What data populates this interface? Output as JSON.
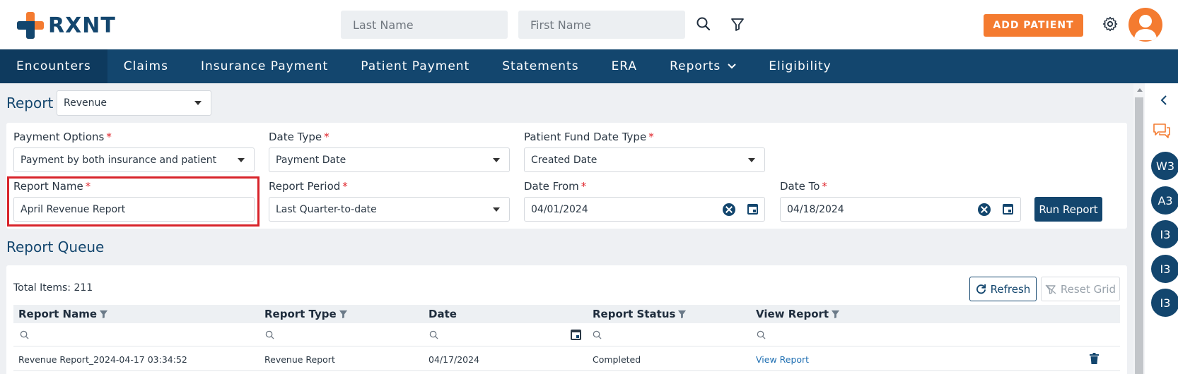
{
  "brand": {
    "name": "RXNT",
    "orange": "#f47b30",
    "navy": "#13466e"
  },
  "header": {
    "last_name_placeholder": "Last Name",
    "first_name_placeholder": "First Name",
    "add_patient_label": "ADD PATIENT",
    "icons": [
      "search-icon",
      "filter-icon",
      "settings-gear-icon",
      "user-avatar"
    ]
  },
  "nav": {
    "items": [
      {
        "label": "Encounters",
        "active": true
      },
      {
        "label": "Claims"
      },
      {
        "label": "Insurance Payment"
      },
      {
        "label": "Patient Payment"
      },
      {
        "label": "Statements"
      },
      {
        "label": "ERA"
      },
      {
        "label": "Reports",
        "dropdown": true
      },
      {
        "label": "Eligibility"
      }
    ]
  },
  "report": {
    "label": "Report",
    "selected": "Revenue"
  },
  "form": {
    "payment_options": {
      "label": "Payment Options",
      "value": "Payment by both insurance and patient"
    },
    "date_type": {
      "label": "Date Type",
      "value": "Payment Date"
    },
    "patient_fund_date_type": {
      "label": "Patient Fund Date Type",
      "value": "Created Date"
    },
    "report_name": {
      "label": "Report Name",
      "value": "April Revenue Report"
    },
    "report_period": {
      "label": "Report Period",
      "value": "Last Quarter-to-date"
    },
    "date_from": {
      "label": "Date From",
      "value": "04/01/2024"
    },
    "date_to": {
      "label": "Date To",
      "value": "04/18/2024"
    },
    "required_mark": "*",
    "run_report_label": "Run Report"
  },
  "queue": {
    "title": "Report Queue",
    "total_items": "Total Items: 211",
    "refresh_label": "Refresh",
    "reset_grid_label": "Reset Grid",
    "columns": [
      "Report Name",
      "Report Type",
      "Date",
      "Report Status",
      "View Report"
    ],
    "rows": [
      {
        "report_name": "Revenue Report_2024-04-17 03:34:52",
        "report_type": "Revenue Report",
        "date": "04/17/2024",
        "status": "Completed",
        "view": "View Report"
      }
    ]
  },
  "right_sidebar": {
    "badges": [
      "W3",
      "A3",
      "I3",
      "I3",
      "I3"
    ]
  }
}
